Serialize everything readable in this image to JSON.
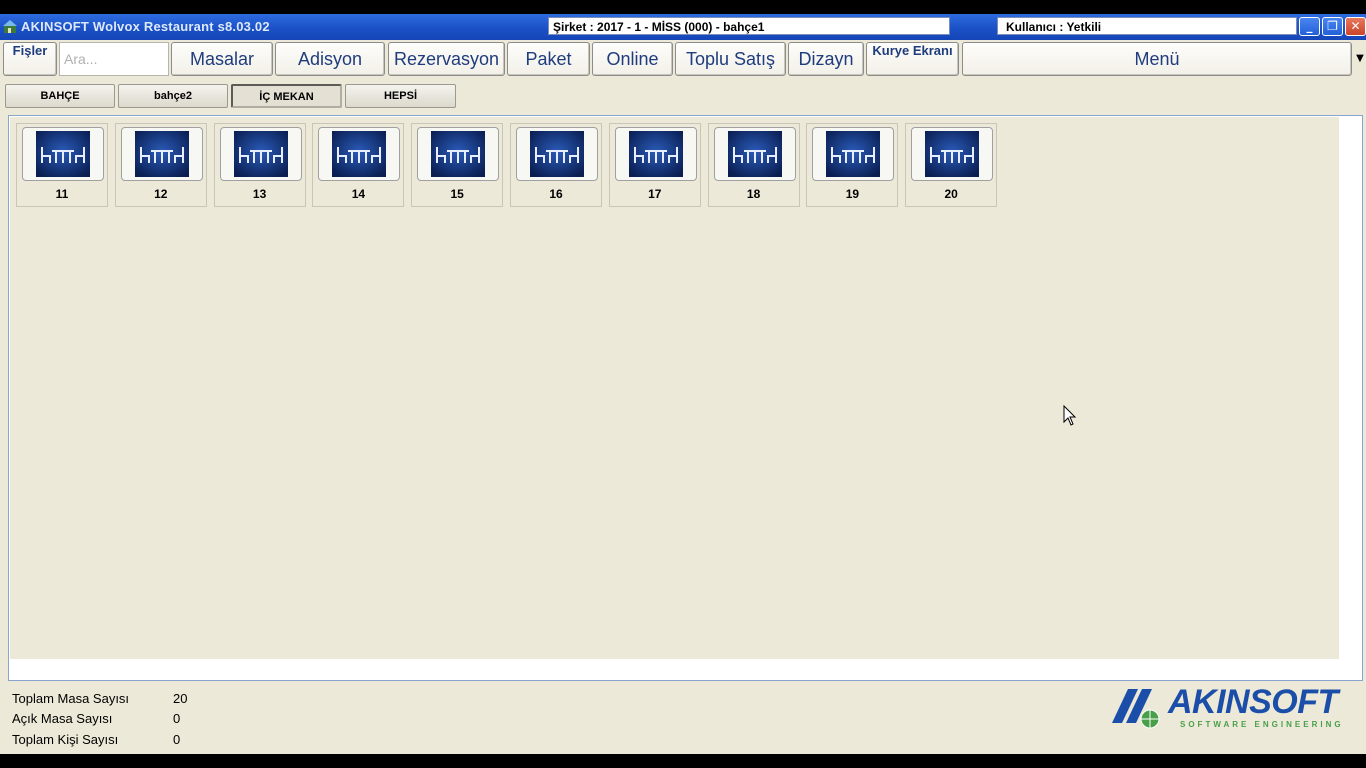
{
  "window": {
    "title": "AKINSOFT Wolvox Restaurant s8.03.02",
    "company_info": "Şirket : 2017 - 1 - MİSS (000) - bahçe1",
    "user_info": "Kullanıcı : Yetkili",
    "minimize": "_",
    "maximize": "❐",
    "close": "✕"
  },
  "toolbar": {
    "fisler": "Fişler",
    "search_placeholder": "Ara...",
    "masalar": "Masalar",
    "adisyon": "Adisyon",
    "rezervasyon": "Rezervasyon",
    "paket": "Paket",
    "online": "Online",
    "toplu_satis": "Toplu Satış",
    "dizayn": "Dizayn",
    "kurye": "Kurye Ekranı",
    "menu": "Menü",
    "menu_arrow": "▼"
  },
  "tabs": [
    "BAHÇE",
    "bahçe2",
    "İÇ MEKAN",
    "HEPSİ"
  ],
  "active_tab": "İÇ MEKAN",
  "tables": [
    "11",
    "12",
    "13",
    "14",
    "15",
    "16",
    "17",
    "18",
    "19",
    "20"
  ],
  "table_icon": "dining-table-icon",
  "status": {
    "total_tables_label": "Toplam Masa Sayısı",
    "total_tables_value": "20",
    "open_tables_label": "Açık Masa Sayısı",
    "open_tables_value": "0",
    "total_people_label": "Toplam Kişi Sayısı",
    "total_people_value": "0"
  },
  "logo": {
    "text": "AKINSOFT",
    "subtitle": "SOFTWARE ENGINEERING"
  },
  "colors": {
    "titlebar": "#1A4FC4",
    "background": "#ECE9D8",
    "button_text": "#1F3C7E",
    "table_icon_bg": "#0E2A6B",
    "logo_blue": "#1B4EA8",
    "logo_green": "#4AA04A"
  }
}
